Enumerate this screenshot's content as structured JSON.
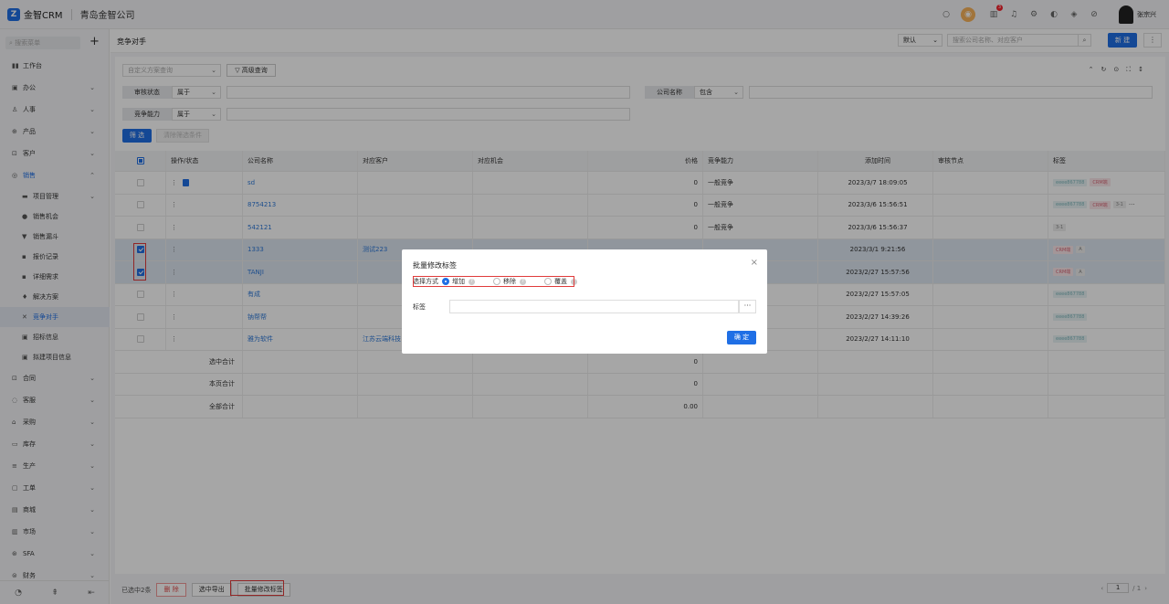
{
  "app": {
    "logo": "金智CRM",
    "company": "青岛金智公司",
    "user": "张宗兴",
    "badge": "3"
  },
  "sidebar": {
    "search_placeholder": "搜索菜单",
    "items": [
      {
        "icon": "workbench-icon",
        "glyph": "▮▮",
        "label": "工作台"
      },
      {
        "icon": "office-icon",
        "glyph": "▣",
        "label": "办公",
        "chev": "⌄"
      },
      {
        "icon": "hr-icon",
        "glyph": "♙",
        "label": "人事",
        "chev": "⌄"
      },
      {
        "icon": "product-icon",
        "glyph": "⊕",
        "label": "产品",
        "chev": "⌄"
      },
      {
        "icon": "customer-icon",
        "glyph": "⊡",
        "label": "客户",
        "chev": "⌄"
      },
      {
        "icon": "sales-icon",
        "glyph": "◎",
        "label": "销售",
        "chev": "⌃"
      }
    ],
    "sales_sub": [
      {
        "icon": "project-icon",
        "glyph": "▬",
        "label": "项目管理",
        "chev": "⌄"
      },
      {
        "icon": "opportunity-icon",
        "glyph": "●",
        "label": "销售机会"
      },
      {
        "icon": "funnel-icon",
        "glyph": "▼",
        "label": "销售漏斗"
      },
      {
        "icon": "quote-icon",
        "glyph": "▪",
        "label": "报价记录"
      },
      {
        "icon": "requirement-icon",
        "glyph": "▪",
        "label": "详细需求"
      },
      {
        "icon": "solution-icon",
        "glyph": "♦",
        "label": "解决方案"
      },
      {
        "icon": "competitor-icon",
        "glyph": "✕",
        "label": "竞争对手"
      },
      {
        "icon": "bid-icon",
        "glyph": "▣",
        "label": "招标信息"
      },
      {
        "icon": "build-project-icon",
        "glyph": "▣",
        "label": "拟建项目信息"
      }
    ],
    "items2": [
      {
        "icon": "contract-icon",
        "glyph": "⊡",
        "label": "合同",
        "chev": "⌄"
      },
      {
        "icon": "service-icon",
        "glyph": "◌",
        "label": "客服",
        "chev": "⌄"
      },
      {
        "icon": "purchase-icon",
        "glyph": "⌂",
        "label": "采购",
        "chev": "⌄"
      },
      {
        "icon": "stock-icon",
        "glyph": "▭",
        "label": "库存",
        "chev": "⌄"
      },
      {
        "icon": "production-icon",
        "glyph": "≡",
        "label": "生产",
        "chev": "⌄"
      },
      {
        "icon": "workorder-icon",
        "glyph": "▢",
        "label": "工单",
        "chev": "⌄"
      },
      {
        "icon": "mall-icon",
        "glyph": "▤",
        "label": "商城",
        "chev": "⌄"
      },
      {
        "icon": "market-icon",
        "glyph": "▥",
        "label": "市场",
        "chev": "⌄"
      },
      {
        "icon": "sfa-icon",
        "glyph": "⊛",
        "label": "SFA",
        "chev": "⌄"
      },
      {
        "icon": "finance-icon",
        "glyph": "⊜",
        "label": "财务",
        "chev": "⌄"
      }
    ]
  },
  "header": {
    "title": "竞争对手",
    "view_select": "默认",
    "search_placeholder": "搜索公司名称、对应客户",
    "new_label": "新 建",
    "more_label": "⋮"
  },
  "filters": {
    "plan_placeholder": "自定义方案查询",
    "advanced": "▽ 高级查询",
    "f1": {
      "label": "审核状态",
      "op": "属于"
    },
    "f2": {
      "label": "公司名称",
      "op": "包含"
    },
    "f3": {
      "label": "竞争能力",
      "op": "属于"
    },
    "filter_btn": "筛 选",
    "clear_btn": "清除筛选条件"
  },
  "table": {
    "columns": [
      "操作/状态",
      "公司名称",
      "对应客户",
      "对应机会",
      "价格",
      "竞争能力",
      "添加时间",
      "审核节点",
      "标签"
    ],
    "rows": [
      {
        "company": "sd",
        "customer": "",
        "price": "0",
        "ability": "一般竞争",
        "time": "2023/3/7 18:09:05",
        "tags": [
          {
            "t": "eeee867788",
            "c": "teal"
          },
          {
            "t": "CRM端",
            "c": "pink"
          }
        ],
        "checked": false,
        "doc": true
      },
      {
        "company": "8754213",
        "customer": "",
        "price": "0",
        "ability": "一般竞争",
        "time": "2023/3/6 15:56:51",
        "tags": [
          {
            "t": "eeee867788",
            "c": "teal"
          },
          {
            "t": "CRM端",
            "c": "pink"
          },
          {
            "t": "3-1",
            "c": "gray"
          }
        ],
        "checked": false,
        "more": "···"
      },
      {
        "company": "542121",
        "customer": "",
        "price": "0",
        "ability": "一般竞争",
        "time": "2023/3/6 15:56:37",
        "tags": [
          {
            "t": "3-1",
            "c": "gray"
          }
        ],
        "checked": false
      },
      {
        "company": "1333",
        "customer": "测试223",
        "price": "",
        "ability": "",
        "time": "2023/3/1 9:21:56",
        "tags": [
          {
            "t": "CRM端",
            "c": "pink"
          },
          {
            "t": "A",
            "c": "gray"
          }
        ],
        "checked": true
      },
      {
        "company": "TANJI",
        "customer": "",
        "price": "",
        "ability": "",
        "time": "2023/2/27 15:57:56",
        "tags": [
          {
            "t": "CRM端",
            "c": "pink"
          },
          {
            "t": "A",
            "c": "gray"
          }
        ],
        "checked": true
      },
      {
        "company": "有成",
        "customer": "",
        "price": "",
        "ability": "",
        "time": "2023/2/27 15:57:05",
        "tags": [
          {
            "t": "eeee867788",
            "c": "teal"
          }
        ],
        "checked": false
      },
      {
        "company": "钠帮帮",
        "customer": "",
        "price": "",
        "ability": "",
        "time": "2023/2/27 14:39:26",
        "tags": [
          {
            "t": "eeee867788",
            "c": "teal"
          }
        ],
        "checked": false
      },
      {
        "company": "雅为软件",
        "customer": "江苏云端科技",
        "price": "",
        "ability": "",
        "time": "2023/2/27 14:11:10",
        "tags": [
          {
            "t": "eeee867788",
            "c": "teal"
          }
        ],
        "checked": false
      }
    ],
    "summary": [
      {
        "label": "选中合计",
        "value": "0"
      },
      {
        "label": "本页合计",
        "value": "0"
      },
      {
        "label": "全部合计",
        "value": "0.00"
      }
    ]
  },
  "bottom": {
    "selected_text": "已选中2条",
    "delete": "删 除",
    "export": "选中导出",
    "batch_tag": "批量修改标签",
    "page": "1",
    "total": "/ 1",
    "prev": "‹",
    "next": "›"
  },
  "modal": {
    "title": "批量修改标签",
    "mode_label": "选择方式",
    "options": [
      "增加",
      "移除",
      "覆盖"
    ],
    "tag_label": "标签",
    "ok": "确 定",
    "close": "×"
  }
}
